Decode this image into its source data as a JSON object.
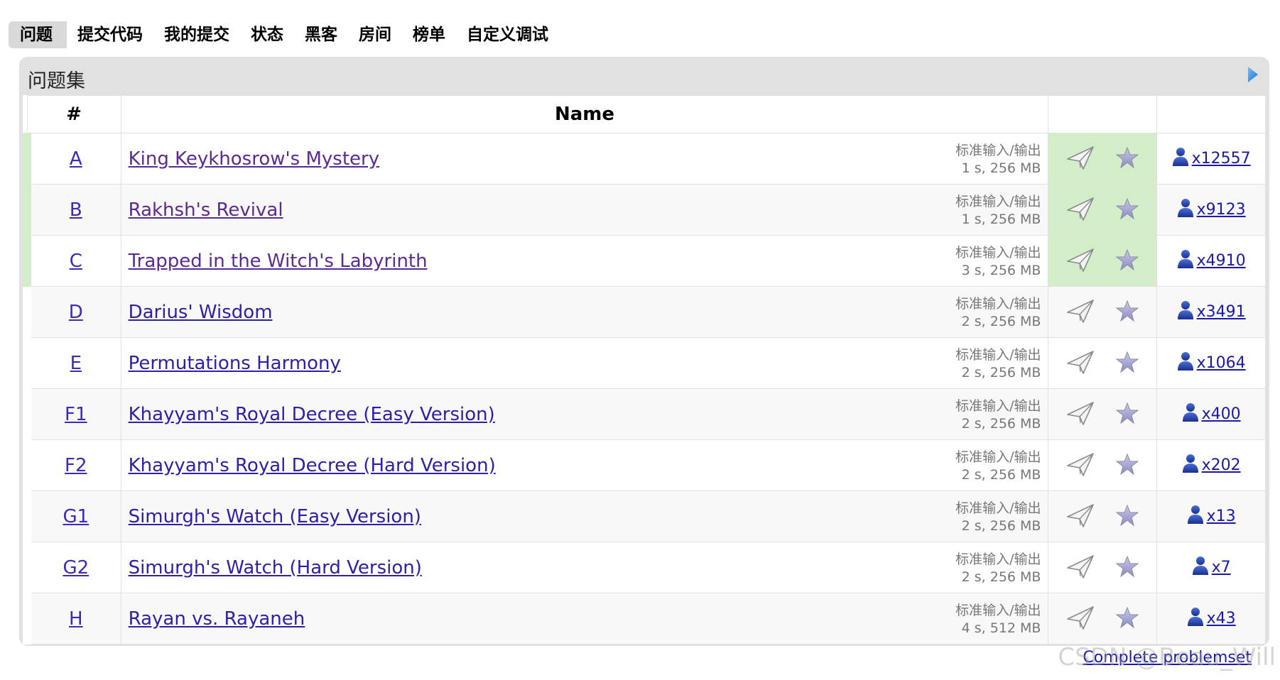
{
  "menu": {
    "items": [
      "问题",
      "提交代码",
      "我的提交",
      "状态",
      "黑客",
      "房间",
      "榜单",
      "自定义调试"
    ],
    "active_index": 0
  },
  "panel": {
    "title": "问题集"
  },
  "table": {
    "headers": {
      "index": "#",
      "name": "Name"
    },
    "io_label": "标准输入/输出",
    "rows": [
      {
        "index": "A",
        "name": "King Keykhosrow's Mystery",
        "limits": "1 s, 256 MB",
        "count": "x12557",
        "solved": true
      },
      {
        "index": "B",
        "name": "Rakhsh's Revival",
        "limits": "1 s, 256 MB",
        "count": "x9123",
        "solved": true
      },
      {
        "index": "C",
        "name": "Trapped in the Witch's Labyrinth",
        "limits": "3 s, 256 MB",
        "count": "x4910",
        "solved": true
      },
      {
        "index": "D",
        "name": "Darius' Wisdom",
        "limits": "2 s, 256 MB",
        "count": "x3491",
        "solved": false
      },
      {
        "index": "E",
        "name": "Permutations Harmony",
        "limits": "2 s, 256 MB",
        "count": "x1064",
        "solved": false
      },
      {
        "index": "F1",
        "name": "Khayyam's Royal Decree (Easy Version)",
        "limits": "2 s, 256 MB",
        "count": "x400",
        "solved": false
      },
      {
        "index": "F2",
        "name": "Khayyam's Royal Decree (Hard Version)",
        "limits": "2 s, 256 MB",
        "count": "x202",
        "solved": false
      },
      {
        "index": "G1",
        "name": "Simurgh's Watch (Easy Version)",
        "limits": "2 s, 256 MB",
        "count": "x13",
        "solved": false
      },
      {
        "index": "G2",
        "name": "Simurgh's Watch (Hard Version)",
        "limits": "2 s, 256 MB",
        "count": "x7",
        "solved": false
      },
      {
        "index": "H",
        "name": "Rayan vs. Rayaneh",
        "limits": "4 s, 512 MB",
        "count": "x43",
        "solved": false
      }
    ]
  },
  "footer": {
    "complete_problemset": "Complete problemset",
    "watermark": "CSDN @Beau_Will"
  },
  "colors": {
    "solved_bg": "#d4edc9",
    "link": "#1a1aa6",
    "panel_bg": "#e1e1e1"
  },
  "icons": {
    "submit": "paper-plane-icon",
    "favorite": "star-icon",
    "solvers": "user-icon",
    "panel_toggle": "triangle-right-icon"
  }
}
